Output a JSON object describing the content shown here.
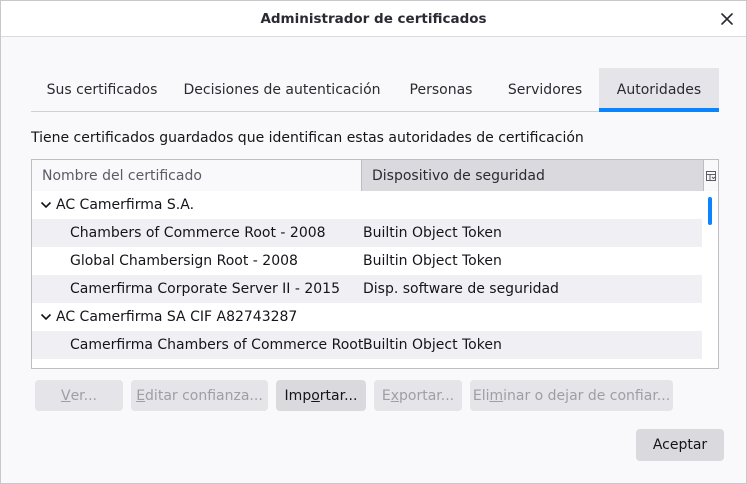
{
  "window": {
    "title": "Administrador de certificados"
  },
  "tabs": [
    {
      "label": "Sus certificados"
    },
    {
      "label": "Decisiones de autenticación"
    },
    {
      "label": "Personas"
    },
    {
      "label": "Servidores"
    },
    {
      "label": "Autoridades",
      "selected": true
    }
  ],
  "description": "Tiene certificados guardados que identifican estas autoridades de certificación",
  "tree": {
    "columns": [
      {
        "label": "Nombre del certificado"
      },
      {
        "label": "Dispositivo de seguridad"
      }
    ],
    "rows": [
      {
        "type": "group",
        "name": "AC Camerfirma S.A.",
        "device": ""
      },
      {
        "type": "child",
        "name": "Chambers of Commerce Root - 2008",
        "device": "Builtin Object Token"
      },
      {
        "type": "child",
        "name": "Global Chambersign Root - 2008",
        "device": "Builtin Object Token"
      },
      {
        "type": "child",
        "name": "Camerfirma Corporate Server II - 2015",
        "device": "Disp. software de seguridad"
      },
      {
        "type": "group",
        "name": "AC Camerfirma SA CIF A82743287",
        "device": ""
      },
      {
        "type": "child",
        "name": "Camerfirma Chambers of Commerce Root",
        "device": "Builtin Object Token"
      }
    ]
  },
  "buttons": {
    "view": {
      "pre": "",
      "mn": "V",
      "post": "er...",
      "enabled": false
    },
    "edit": {
      "pre": "",
      "mn": "E",
      "post": "ditar confianza...",
      "enabled": false
    },
    "import": {
      "pre": "Imp",
      "mn": "o",
      "post": "rtar...",
      "enabled": true
    },
    "export": {
      "pre": "E",
      "mn": "x",
      "post": "portar...",
      "enabled": false
    },
    "delete": {
      "pre": "Eli",
      "mn": "m",
      "post": "inar o dejar de confiar...",
      "enabled": false
    }
  },
  "accept_label": "Aceptar",
  "icons": {
    "close": "close-icon",
    "twisty": "chevron-down-icon",
    "column_picker": "column-picker-icon"
  },
  "colors": {
    "accent": "#0a84ff",
    "selected_tab_bg": "#e4e4e9"
  }
}
